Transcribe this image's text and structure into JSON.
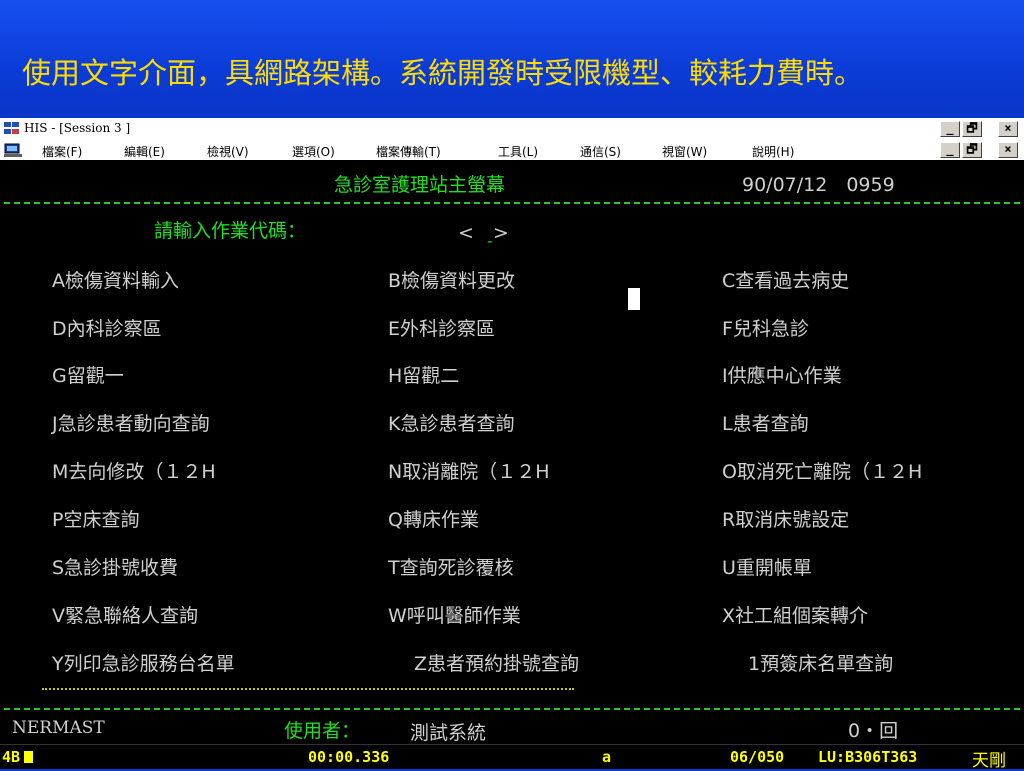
{
  "slide": {
    "heading": "使用文字介面，具網路架構。系統開發時受限機型、較耗力費時。"
  },
  "window": {
    "title": "HIS - [Session 3 ]",
    "controls": {
      "minimize": "_",
      "restore": "🗗",
      "close": "×"
    }
  },
  "menu": [
    "檔案(F)",
    "編輯(E)",
    "檢視(V)",
    "選項(O)",
    "檔案傳輸(T)",
    "工具(L)",
    "通信(S)",
    "視窗(W)",
    "說明(H)"
  ],
  "screen": {
    "title": "急診室護理站主螢幕",
    "datetime": "90/07/12　0959",
    "prompt_label": "請輸入作業代碼：",
    "input_brackets": "<　>",
    "input_cursor": "-",
    "options": [
      [
        "A檢傷資料輸入",
        "B檢傷資料更改",
        "C查看過去病史"
      ],
      [
        "D內科診察區",
        "E外科診察區",
        "F兒科急診"
      ],
      [
        "G留觀一",
        "H留觀二",
        "I供應中心作業"
      ],
      [
        "J急診患者動向查詢",
        "K急診患者查詢",
        "L患者查詢"
      ],
      [
        "M去向修改（１２H",
        "N取消離院（１２H",
        "O取消死亡離院（１２H"
      ],
      [
        "P空床查詢",
        "Q轉床作業",
        "R取消床號設定"
      ],
      [
        "S急診掛號收費",
        "T查詢死診覆核",
        "U重開帳單"
      ],
      [
        "V緊急聯絡人查詢",
        "W呼叫醫師作業",
        "X社工組個案轉介"
      ],
      [
        "Y列印急診服務台名單",
        "Z患者預約掛號查詢",
        "1預簽床名單查詢"
      ]
    ],
    "footer": {
      "program": "NERMAST",
      "user_label": "使用者：",
      "user_name": "測試系統",
      "page": "0・回"
    }
  },
  "statusbar": {
    "mode": "4B",
    "timer": "00:00.336",
    "symbol": "a",
    "position": "06/050",
    "lu": "LU:B306T363",
    "ime": "天剛"
  }
}
